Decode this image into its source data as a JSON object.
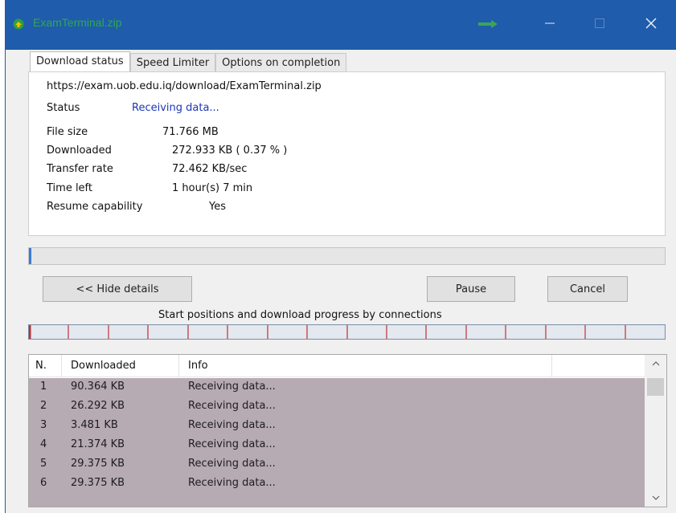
{
  "window": {
    "title": "ExamTerminal.zip",
    "colors": {
      "titlebar": "#1f5cab",
      "title_text": "#2fa84f",
      "status_text": "#1d35b8",
      "list_rows": "#b6aab3"
    }
  },
  "tabs": [
    {
      "label": "Download status",
      "active": true
    },
    {
      "label": "Speed Limiter",
      "active": false
    },
    {
      "label": "Options on completion",
      "active": false
    }
  ],
  "status": {
    "url": "https://exam.uob.edu.iq/download/ExamTerminal.zip",
    "status_label": "Status",
    "status_value": "Receiving data...",
    "file_size_label": "File size",
    "file_size_value": "71.766  MB",
    "downloaded_label": "Downloaded",
    "downloaded_value": "272.933  KB  ( 0.37 % )",
    "transfer_rate_label": "Transfer rate",
    "transfer_rate_value": "72.462  KB/sec",
    "time_left_label": "Time left",
    "time_left_value": "1 hour(s) 7 min",
    "resume_label": "Resume capability",
    "resume_value": "Yes"
  },
  "progress": {
    "fraction": 0.0037
  },
  "buttons": {
    "hide_details": "<< Hide details",
    "pause": "Pause",
    "cancel": "Cancel"
  },
  "connections": {
    "label": "Start positions and download progress by connections",
    "count": 16
  },
  "list": {
    "headers": {
      "number": "N.",
      "downloaded": "Downloaded",
      "info": "Info"
    },
    "rows": [
      {
        "n": "1",
        "downloaded": "90.364  KB",
        "info": "Receiving data..."
      },
      {
        "n": "2",
        "downloaded": "26.292  KB",
        "info": "Receiving data..."
      },
      {
        "n": "3",
        "downloaded": "3.481  KB",
        "info": "Receiving data..."
      },
      {
        "n": "4",
        "downloaded": "21.374  KB",
        "info": "Receiving data..."
      },
      {
        "n": "5",
        "downloaded": "29.375  KB",
        "info": "Receiving data..."
      },
      {
        "n": "6",
        "downloaded": "29.375  KB",
        "info": "Receiving data..."
      }
    ]
  },
  "icons": {
    "app": "idm-app-icon",
    "minimize": "minimize-icon",
    "maximize": "maximize-icon",
    "close": "close-icon",
    "scroll_up": "chevron-up-icon",
    "scroll_down": "chevron-down-icon"
  }
}
